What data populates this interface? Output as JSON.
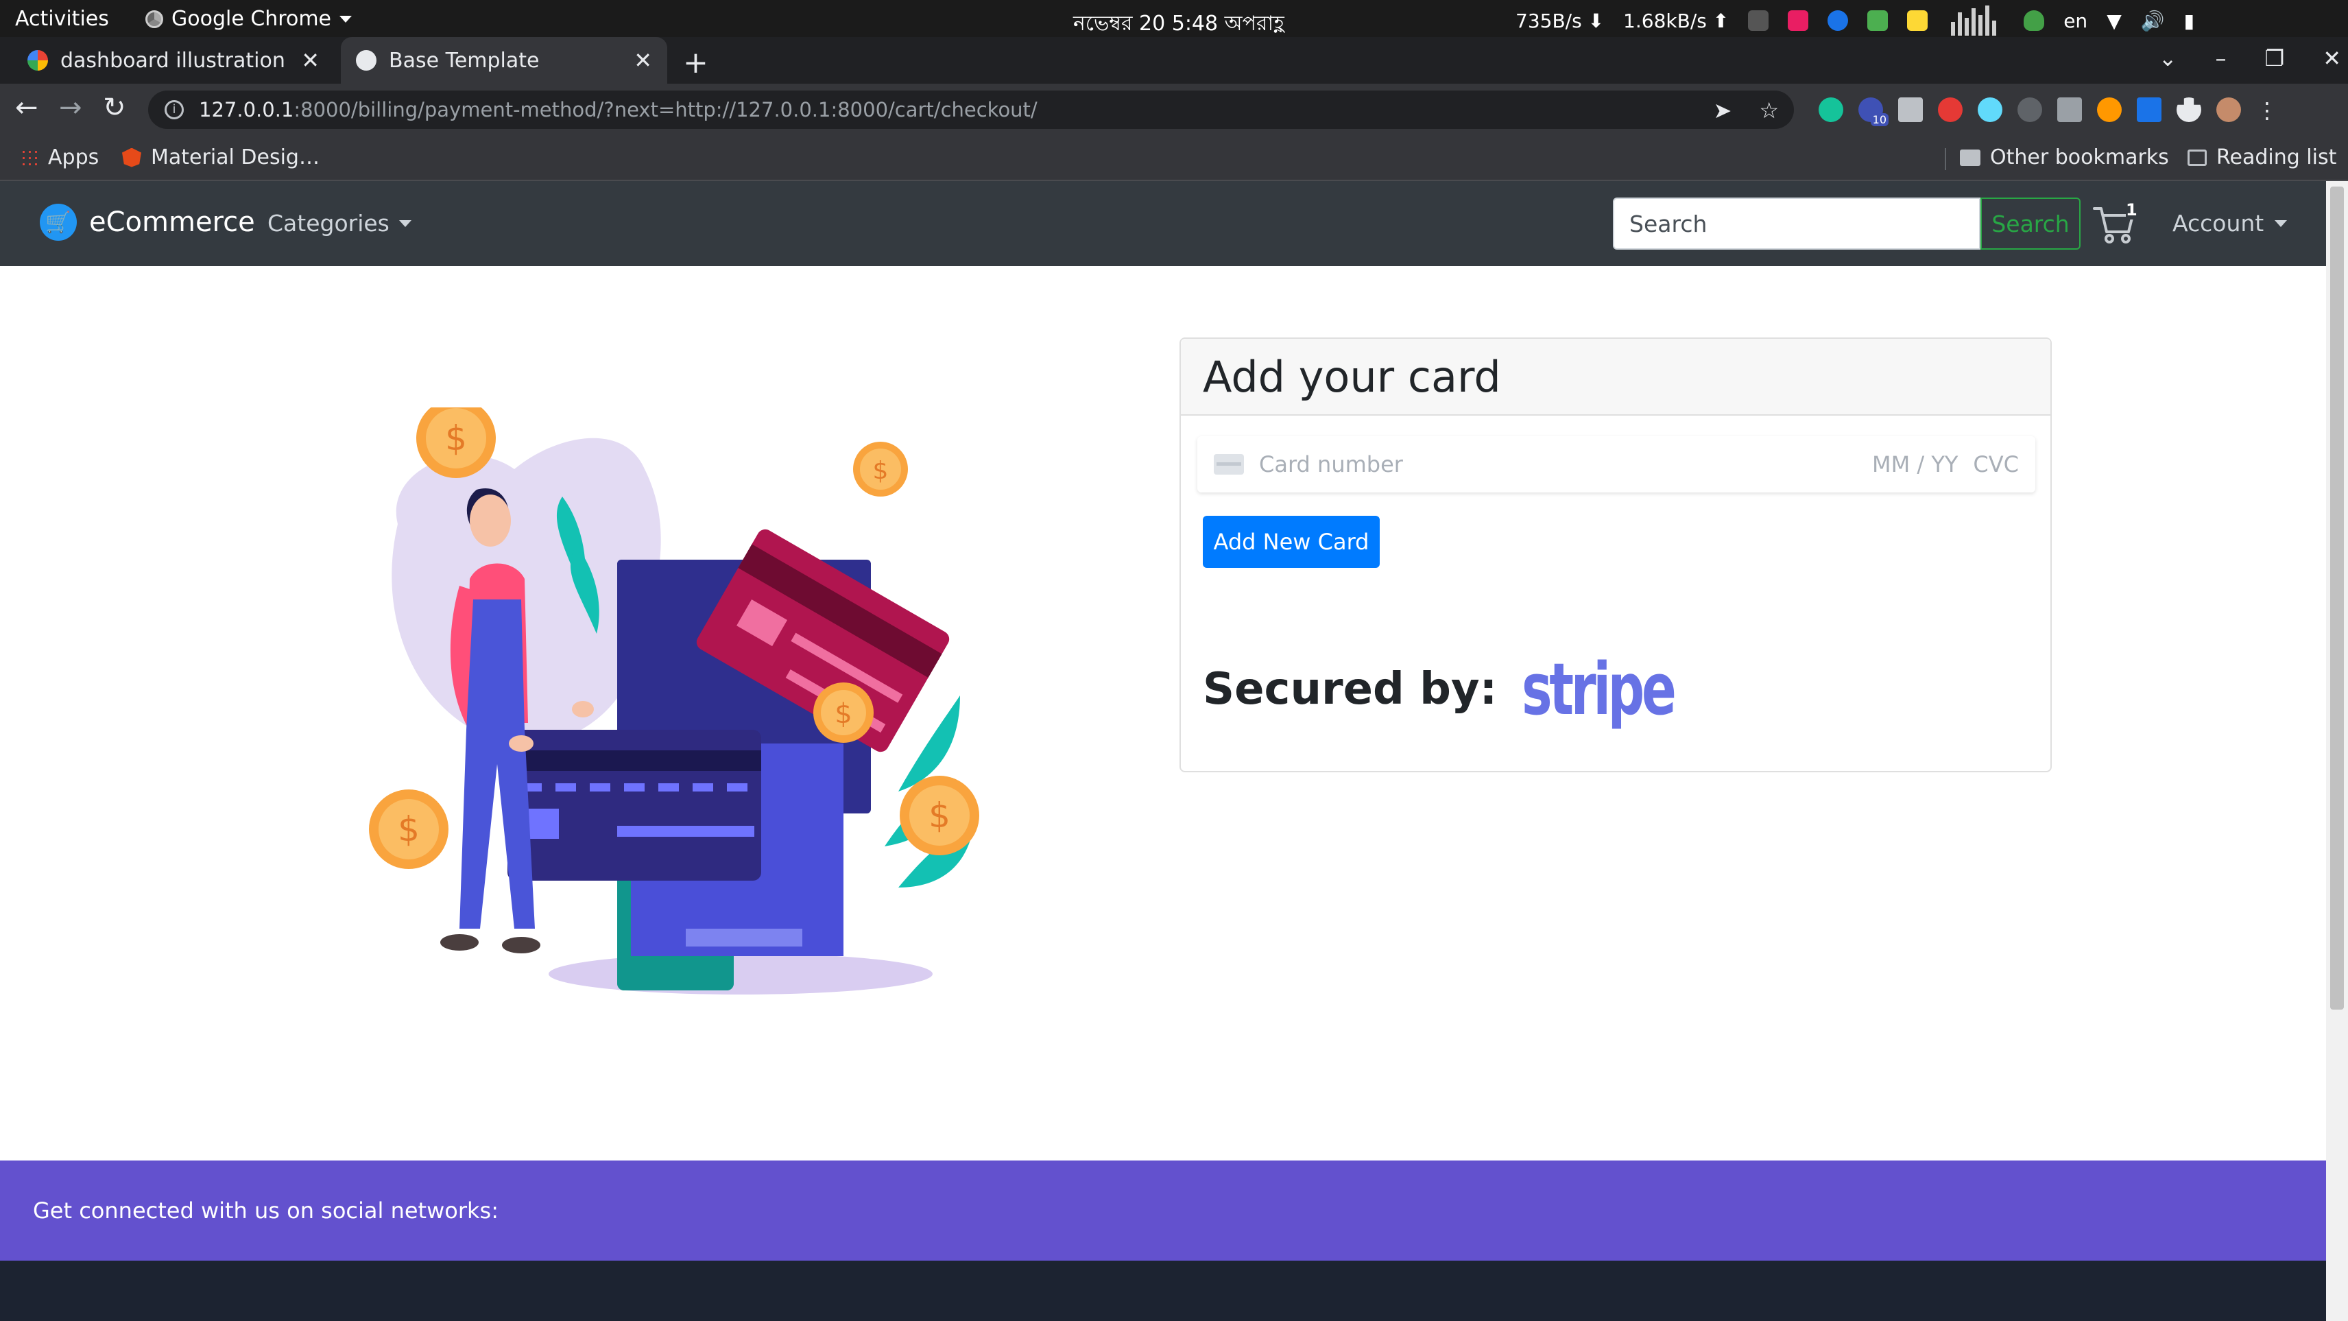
{
  "system_bar": {
    "activities": "Activities",
    "app_name": "Google Chrome",
    "clock": "নভেম্বর 20   5:48 অপরাহ্ণ",
    "net_down": "735B/s ⬇",
    "net_up": "1.68kB/s ⬆",
    "lang": "en"
  },
  "browser": {
    "tabs": [
      {
        "title": "dashboard illustration - Go"
      },
      {
        "title": "Base Template"
      }
    ],
    "url_host": "127.0.0.1",
    "url_path": ":8000/billing/payment-method/?next=http://127.0.0.1:8000/cart/checkout/",
    "extension_badge": "10",
    "bookmarks": {
      "apps": "Apps",
      "material": "Material Desig…",
      "other": "Other bookmarks",
      "reading": "Reading list"
    }
  },
  "site_nav": {
    "brand": "eCommerce",
    "categories": "Categories",
    "search_placeholder": "Search",
    "search_button": "Search",
    "cart_count": "1",
    "account": "Account"
  },
  "payment": {
    "heading": "Add your card",
    "card_number_placeholder": "Card number",
    "expiry_placeholder": "MM / YY",
    "cvc_placeholder": "CVC",
    "add_button": "Add New Card",
    "secured_label": "Secured by:",
    "provider": "stripe"
  },
  "footer": {
    "social_text": "Get connected with us on social networks:"
  },
  "colors": {
    "navbar": "#343a40",
    "primary": "#007bff",
    "success": "#28a745",
    "stripe": "#6772e5",
    "footer_social": "#6351ce",
    "footer_dark": "#1c2331"
  }
}
